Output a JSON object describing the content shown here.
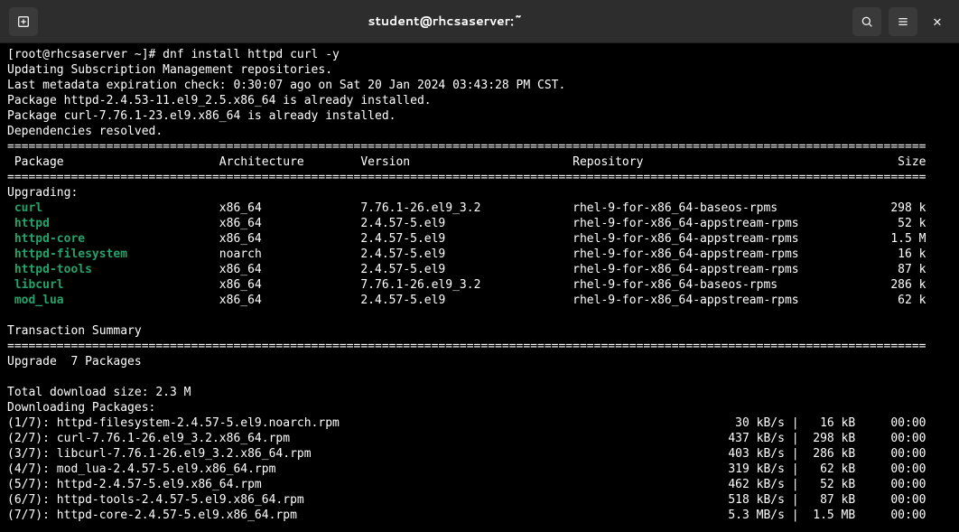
{
  "window": {
    "title": "student@rhcsaserver:~"
  },
  "prompt_line": "[root@rhcsaserver ~]# dnf install httpd curl -y",
  "pre_lines": [
    "Updating Subscription Management repositories.",
    "Last metadata expiration check: 0:30:07 ago on Sat 20 Jan 2024 03:43:28 PM CST.",
    "Package httpd-2.4.53-11.el9_2.5.x86_64 is already installed.",
    "Package curl-7.76.1-23.el9.x86_64 is already installed.",
    "Dependencies resolved."
  ],
  "header_cols": {
    "package": " Package",
    "arch": "Architecture",
    "version": "Version",
    "repo": "Repository",
    "size": "Size"
  },
  "upgrading_label": "Upgrading:",
  "packages": [
    {
      "name": "curl",
      "arch": "x86_64",
      "version": "7.76.1-26.el9_3.2",
      "repo": "rhel-9-for-x86_64-baseos-rpms",
      "size": "298 k"
    },
    {
      "name": "httpd",
      "arch": "x86_64",
      "version": "2.4.57-5.el9",
      "repo": "rhel-9-for-x86_64-appstream-rpms",
      "size": "52 k"
    },
    {
      "name": "httpd-core",
      "arch": "x86_64",
      "version": "2.4.57-5.el9",
      "repo": "rhel-9-for-x86_64-appstream-rpms",
      "size": "1.5 M"
    },
    {
      "name": "httpd-filesystem",
      "arch": "noarch",
      "version": "2.4.57-5.el9",
      "repo": "rhel-9-for-x86_64-appstream-rpms",
      "size": "16 k"
    },
    {
      "name": "httpd-tools",
      "arch": "x86_64",
      "version": "2.4.57-5.el9",
      "repo": "rhel-9-for-x86_64-appstream-rpms",
      "size": "87 k"
    },
    {
      "name": "libcurl",
      "arch": "x86_64",
      "version": "7.76.1-26.el9_3.2",
      "repo": "rhel-9-for-x86_64-baseos-rpms",
      "size": "286 k"
    },
    {
      "name": "mod_lua",
      "arch": "x86_64",
      "version": "2.4.57-5.el9",
      "repo": "rhel-9-for-x86_64-appstream-rpms",
      "size": "62 k"
    }
  ],
  "summary": {
    "txn_summary": "Transaction Summary",
    "upgrade_count": "Upgrade  7 Packages",
    "total_size": "Total download size: 2.3 M",
    "downloading": "Downloading Packages:"
  },
  "downloads": [
    {
      "idx": "(1/7)",
      "file": "httpd-filesystem-2.4.57-5.el9.noarch.rpm",
      "speed": "30 kB/s",
      "size": "16 kB",
      "time": "00:00"
    },
    {
      "idx": "(2/7)",
      "file": "curl-7.76.1-26.el9_3.2.x86_64.rpm",
      "speed": "437 kB/s",
      "size": "298 kB",
      "time": "00:00"
    },
    {
      "idx": "(3/7)",
      "file": "libcurl-7.76.1-26.el9_3.2.x86_64.rpm",
      "speed": "403 kB/s",
      "size": "286 kB",
      "time": "00:00"
    },
    {
      "idx": "(4/7)",
      "file": "mod_lua-2.4.57-5.el9.x86_64.rpm",
      "speed": "319 kB/s",
      "size": "62 kB",
      "time": "00:00"
    },
    {
      "idx": "(5/7)",
      "file": "httpd-2.4.57-5.el9.x86_64.rpm",
      "speed": "462 kB/s",
      "size": "52 kB",
      "time": "00:00"
    },
    {
      "idx": "(6/7)",
      "file": "httpd-tools-2.4.57-5.el9.x86_64.rpm",
      "speed": "518 kB/s",
      "size": "87 kB",
      "time": "00:00"
    },
    {
      "idx": "(7/7)",
      "file": "httpd-core-2.4.57-5.el9.x86_64.rpm",
      "speed": "5.3 MB/s",
      "size": "1.5 MB",
      "time": "00:00"
    }
  ]
}
